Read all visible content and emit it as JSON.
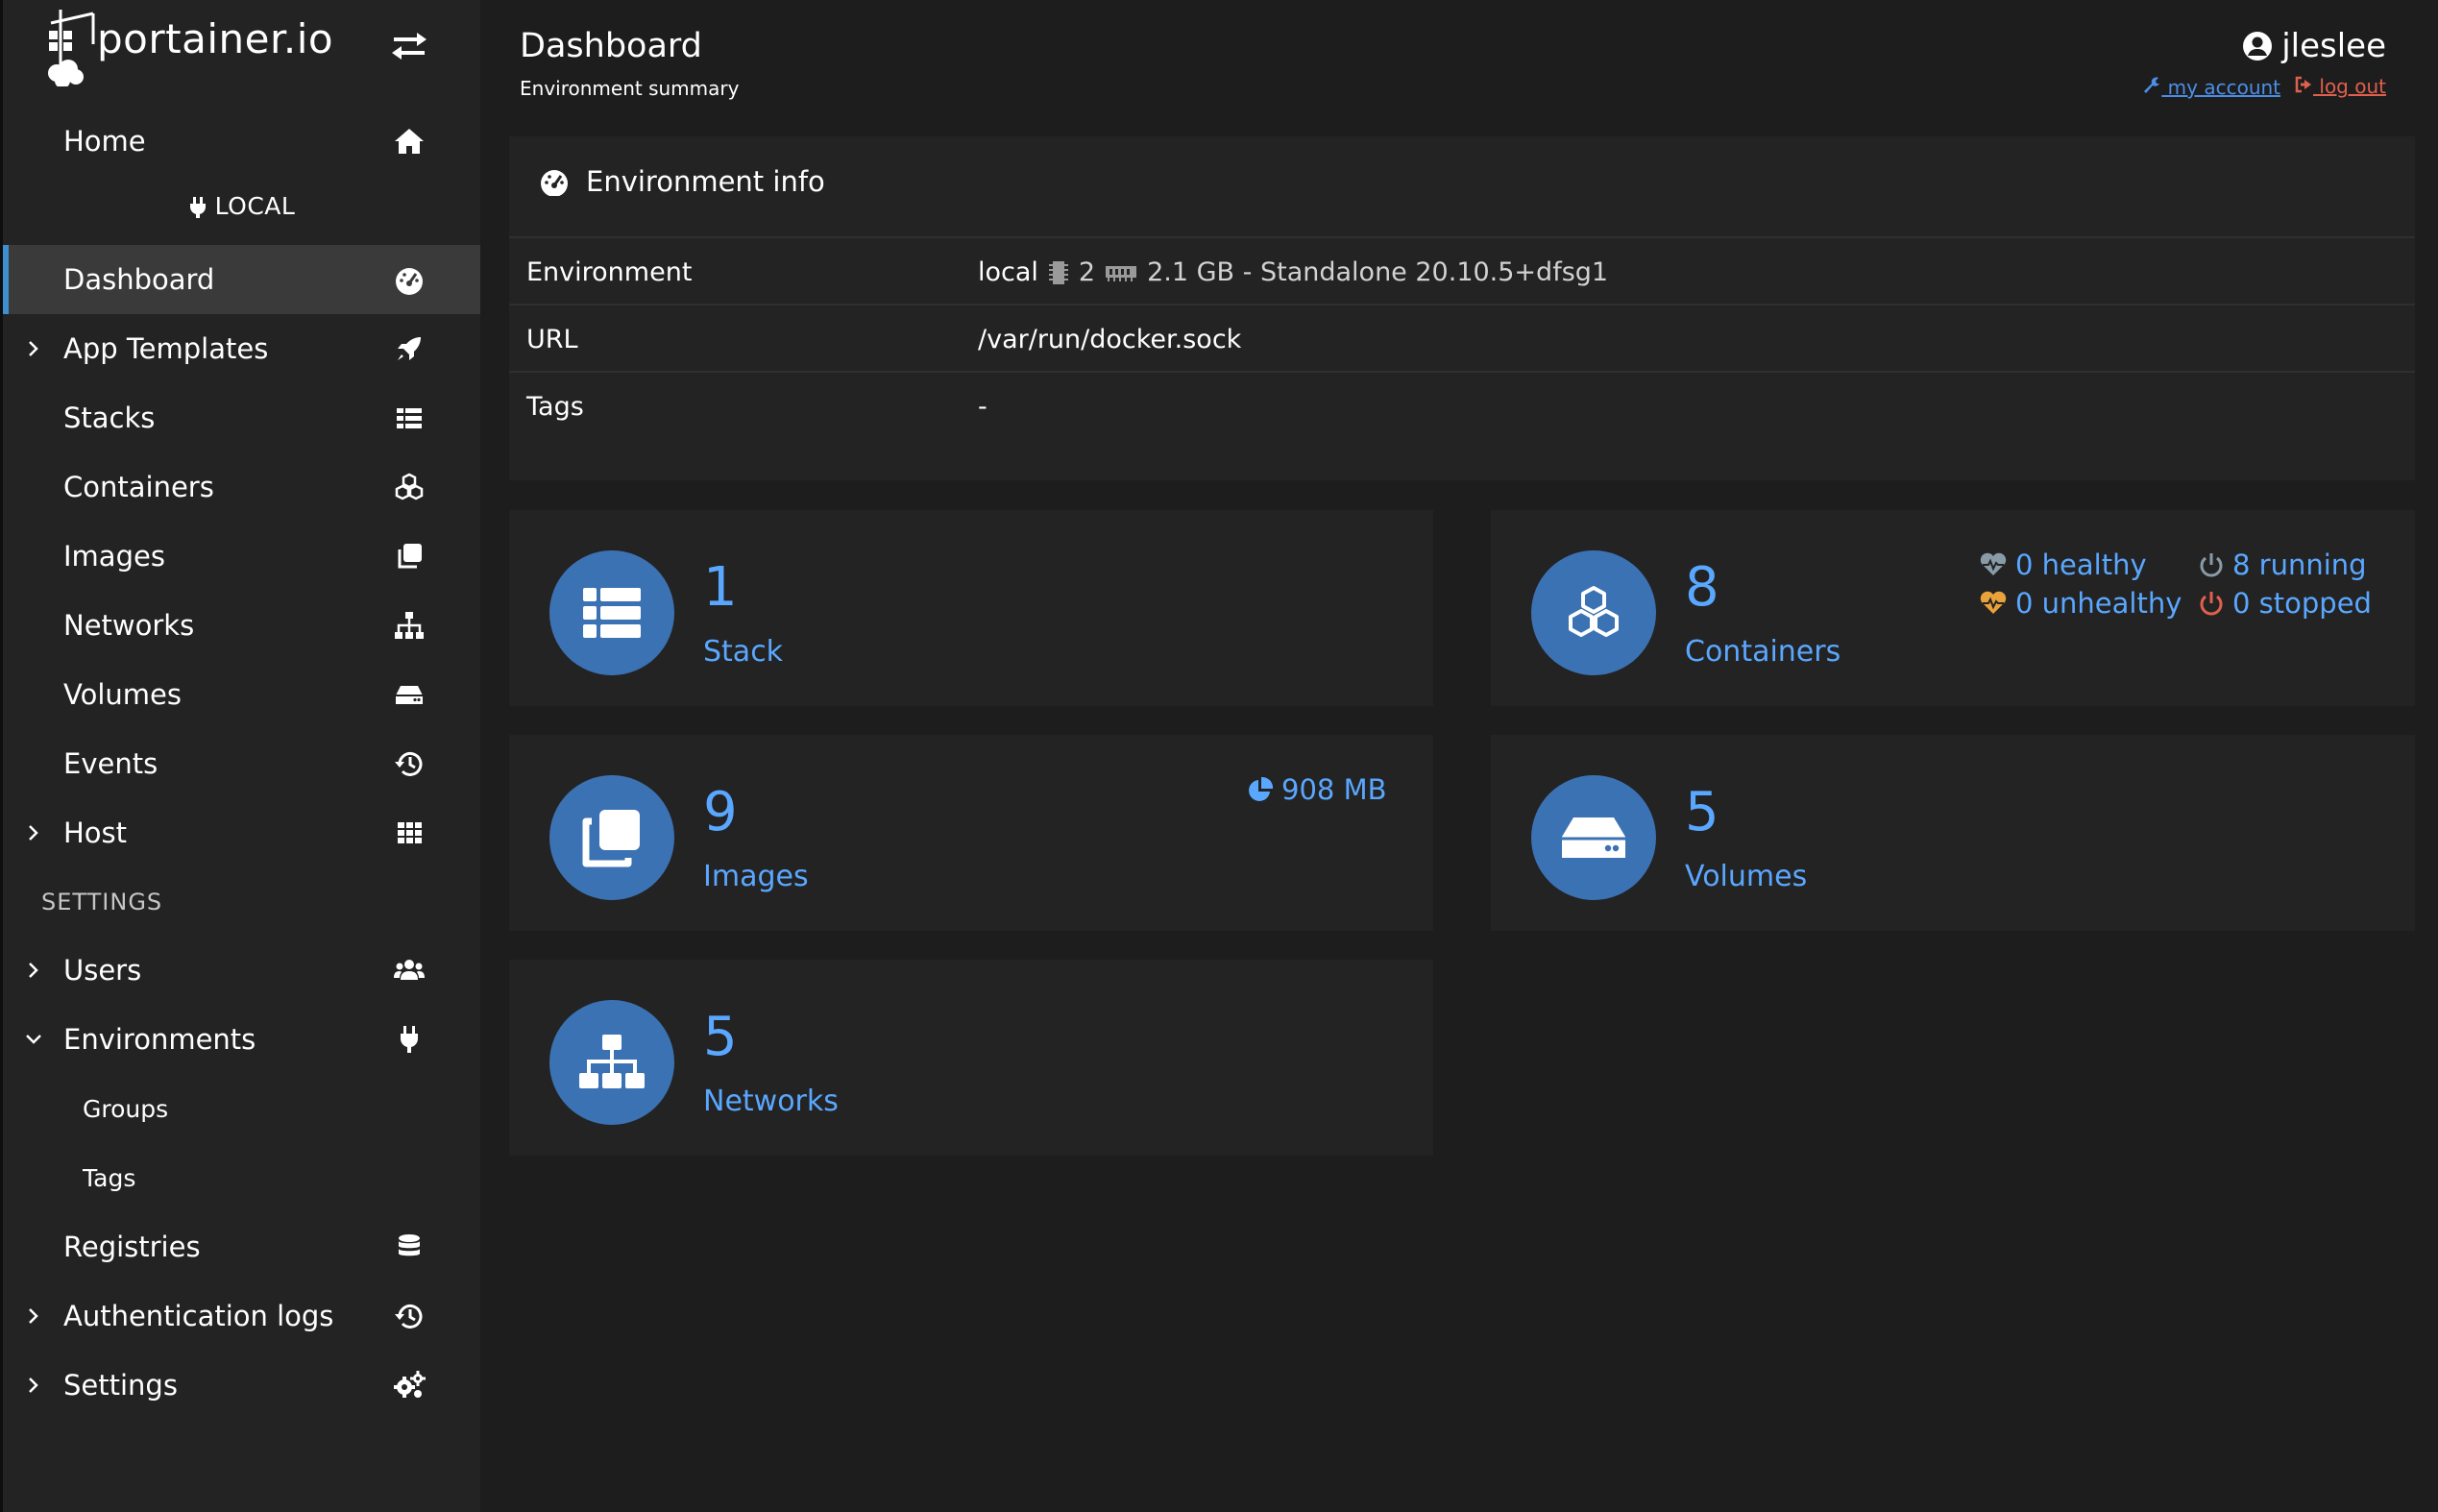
{
  "brand": {
    "logo_text": "portainer.io",
    "logo_icon": "portainer-crane-logo"
  },
  "sidebar": {
    "home": {
      "label": "Home",
      "icon": "home-icon"
    },
    "environment_badge": "LOCAL",
    "items": [
      {
        "label": "Dashboard",
        "icon": "tachometer-icon",
        "active": true
      },
      {
        "label": "App Templates",
        "icon": "rocket-icon",
        "expandable": true
      },
      {
        "label": "Stacks",
        "icon": "list-icon"
      },
      {
        "label": "Containers",
        "icon": "cubes-icon"
      },
      {
        "label": "Images",
        "icon": "clone-icon"
      },
      {
        "label": "Networks",
        "icon": "sitemap-icon"
      },
      {
        "label": "Volumes",
        "icon": "hdd-icon"
      },
      {
        "label": "Events",
        "icon": "history-icon"
      },
      {
        "label": "Host",
        "icon": "grid-icon",
        "expandable": true
      }
    ],
    "settings_header": "SETTINGS",
    "settings_items": [
      {
        "label": "Users",
        "icon": "users-icon"
      },
      {
        "label": "Environments",
        "icon": "plug-icon"
      },
      {
        "label": "Groups"
      },
      {
        "label": "Tags"
      },
      {
        "label": "Registries",
        "icon": "database-icon"
      },
      {
        "label": "Authentication logs",
        "icon": "history-icon"
      },
      {
        "label": "Settings",
        "icon": "cogs-icon"
      }
    ]
  },
  "header": {
    "title": "Dashboard",
    "subtitle": "Environment summary",
    "username": "jleslee",
    "my_account": " my account ",
    "log_out": " log out"
  },
  "env_info": {
    "title": "Environment info",
    "rows": {
      "environment": {
        "key": "Environment",
        "name": "local",
        "cpu": "2",
        "memory_and_type": "2.1 GB - Standalone 20.10.5+dfsg1"
      },
      "url": {
        "key": "URL",
        "value": "/var/run/docker.sock"
      },
      "tags": {
        "key": "Tags",
        "value": "-"
      }
    }
  },
  "tiles": {
    "stack": {
      "count": "1",
      "label": "Stack",
      "icon": "list-icon"
    },
    "containers": {
      "count": "8",
      "label": "Containers",
      "icon": "cubes-icon",
      "healthy": "0 healthy",
      "unhealthy": "0 unhealthy",
      "running": "8 running",
      "stopped": "0 stopped"
    },
    "images": {
      "count": "9",
      "label": "Images",
      "icon": "clone-icon",
      "size": "908 MB"
    },
    "volumes": {
      "count": "5",
      "label": "Volumes",
      "icon": "hdd-icon"
    },
    "networks": {
      "count": "5",
      "label": "Networks",
      "icon": "sitemap-icon"
    }
  },
  "colors": {
    "accent": "#5aa7ff",
    "circle": "#3b72b4",
    "active_bar": "#3d8fcf",
    "warning": "#e9a23b",
    "danger": "#e0604e",
    "muted_icon": "#8a9ba8"
  }
}
